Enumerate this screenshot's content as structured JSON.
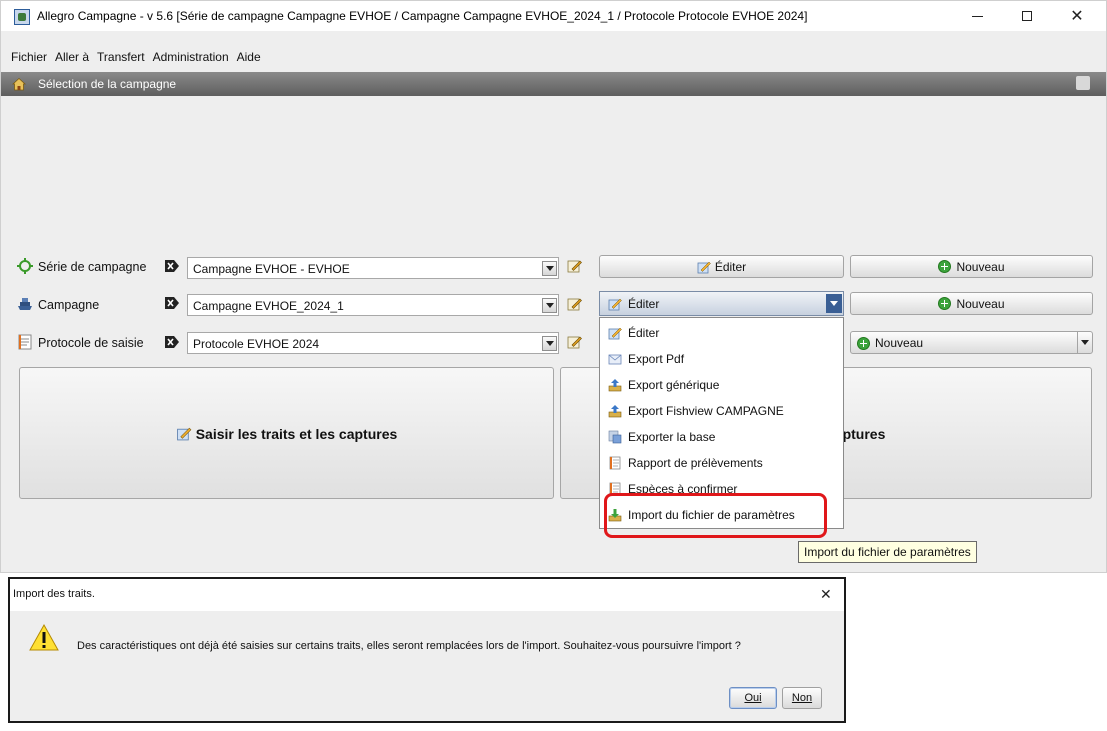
{
  "window": {
    "title": "Allegro Campagne - v 5.6 [Série de campagne Campagne EVHOE / Campagne Campagne EVHOE_2024_1 / Protocole Protocole EVHOE 2024]",
    "minimize": "minimize-icon",
    "maximize": "maximize-icon",
    "close": "✕"
  },
  "menubar": [
    "Fichier",
    "Aller à",
    "Transfert",
    "Administration",
    "Aide"
  ],
  "header": {
    "title": "Sélection de la campagne"
  },
  "rows": {
    "serie": {
      "label": "Série de campagne",
      "value": "Campagne EVHOE - EVHOE",
      "edit_button": "Éditer",
      "new_button": "Nouveau"
    },
    "campagne": {
      "label": "Campagne",
      "value": "Campagne EVHOE_2024_1",
      "edit_dropdown": "Éditer",
      "new_button": "Nouveau"
    },
    "protocole": {
      "label": "Protocole de saisie",
      "value": "Protocole EVHOE 2024",
      "new_button": "Nouveau"
    }
  },
  "panels": {
    "saisir": "Saisir les traits et les captures",
    "second_visible": "captures"
  },
  "popup_menu": [
    {
      "label": "Éditer",
      "icon": "edit-icon"
    },
    {
      "label": "Export Pdf",
      "icon": "envelope-icon"
    },
    {
      "label": "Export générique",
      "icon": "export-icon"
    },
    {
      "label": "Export Fishview CAMPAGNE",
      "icon": "export-icon"
    },
    {
      "label": "Exporter la base",
      "icon": "database-icon"
    },
    {
      "label": "Rapport de prélèvements",
      "icon": "report-icon"
    },
    {
      "label": "Espèces à confirmer",
      "icon": "report-icon"
    },
    {
      "label": "Import du fichier de paramètres",
      "icon": "import-icon"
    }
  ],
  "tooltip": "Import du fichier de paramètres",
  "dialog": {
    "title": "Import des traits.",
    "close": "✕",
    "message": "Des caractéristiques ont déjà été saisies sur certains traits, elles seront remplacées lors de l'import. Souhaitez-vous poursuivre l'import ?",
    "ok_label": "Oui",
    "cancel_label": "Non"
  },
  "colors": {
    "highlight": "#e0171a",
    "header_bar": "#6b6b6b",
    "tooltip_bg": "#ffffe1",
    "dropdown_arrow": "#3a5f95"
  }
}
